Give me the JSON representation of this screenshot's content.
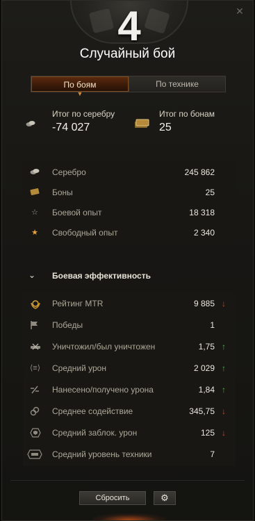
{
  "header": {
    "battle_count": "4",
    "title": "Случайный бой"
  },
  "tabs": [
    {
      "label": "По боям",
      "active": true
    },
    {
      "label": "По технике",
      "active": false
    }
  ],
  "totals": {
    "silver": {
      "label": "Итог по серебру",
      "value": "-74 027",
      "icon": "silver-icon"
    },
    "bonds": {
      "label": "Итог по бонам",
      "value": "25",
      "icon": "bonds-stack-icon"
    }
  },
  "economy": [
    {
      "label": "Серебро",
      "value": "245 862",
      "icon": "silver-icon"
    },
    {
      "label": "Боны",
      "value": "25",
      "icon": "bond-icon"
    },
    {
      "label": "Боевой опыт",
      "value": "18 318",
      "icon": "star-outline-icon"
    },
    {
      "label": "Свободный опыт",
      "value": "2 340",
      "icon": "star-gold-icon"
    }
  ],
  "efficiency": {
    "title": "Боевая эффективность",
    "rows": [
      {
        "label": "Рейтинг MTR",
        "value": "9 885",
        "trend": "down",
        "icon": "laurel-rating-icon"
      },
      {
        "label": "Победы",
        "value": "1",
        "trend": "none",
        "icon": "flag-icon"
      },
      {
        "label": "Уничтожил/был уничтожен",
        "value": "1,75",
        "trend": "up",
        "icon": "destroyed-ratio-icon"
      },
      {
        "label": "Средний урон",
        "value": "2 029",
        "trend": "up",
        "icon": "damage-icon"
      },
      {
        "label": "Нанесено/получено урона",
        "value": "1,84",
        "trend": "up",
        "icon": "damage-ratio-icon"
      },
      {
        "label": "Среднее содействие",
        "value": "345,75",
        "trend": "down",
        "icon": "assist-icon"
      },
      {
        "label": "Средний заблок. урон",
        "value": "125",
        "trend": "down",
        "icon": "shield-icon"
      },
      {
        "label": "Средний уровень техники",
        "value": "7",
        "trend": "none",
        "icon": "tier-icon"
      }
    ]
  },
  "footer": {
    "reset_label": "Сбросить",
    "settings_icon": "gear-icon"
  },
  "colors": {
    "trend_up": "#35c035",
    "trend_down": "#e43a2b",
    "tab_active": "#5a2a0e"
  }
}
